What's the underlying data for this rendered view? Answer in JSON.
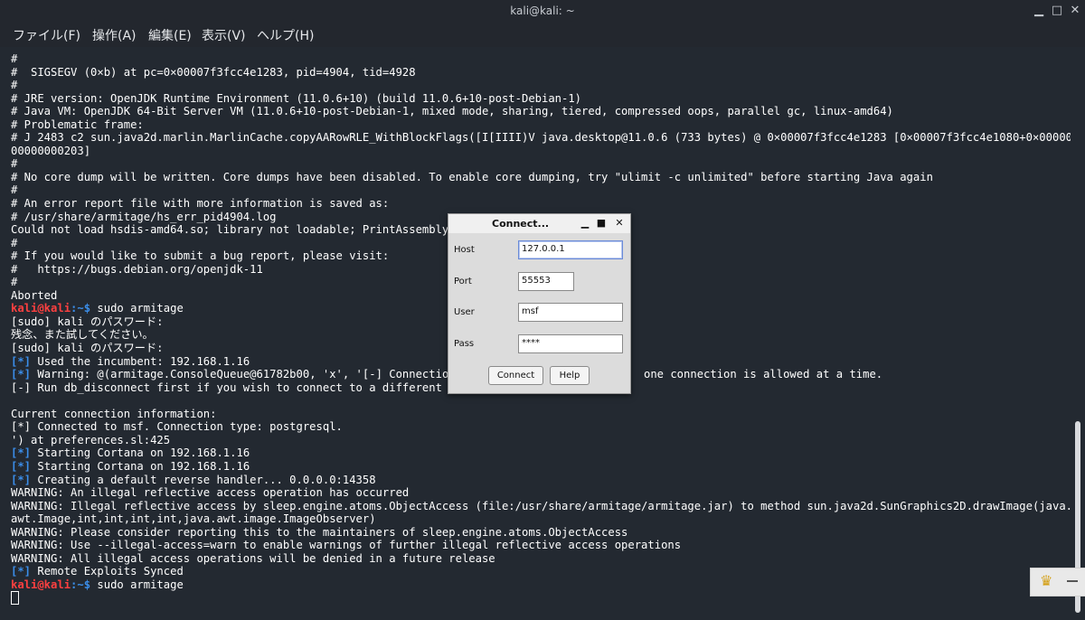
{
  "window": {
    "title": "kali@kali: ~"
  },
  "menu": [
    "ファイル(F)",
    "操作(A)",
    "編集(E)",
    "表示(V)",
    "ヘルプ(H)"
  ],
  "colors": {
    "terminal_bg": "#232931",
    "prompt_red": "#ff4040",
    "info_blue": "#3b8eea"
  },
  "terminal": {
    "lines": [
      "#",
      "#  SIGSEGV (0×b) at pc=0×00007f3fcc4e1283, pid=4904, tid=4928",
      "#",
      "# JRE version: OpenJDK Runtime Environment (11.0.6+10) (build 11.0.6+10-post-Debian-1)",
      "# Java VM: OpenJDK 64-Bit Server VM (11.0.6+10-post-Debian-1, mixed mode, sharing, tiered, compressed oops, parallel gc, linux-amd64)",
      "# Problematic frame:",
      "# J 2483 c2 sun.java2d.marlin.MarlinCache.copyAARowRLE_WithBlockFlags([I[IIII)V java.desktop@11.0.6 (733 bytes) @ 0×00007f3fcc4e1283 [0×00007f3fcc4e1080+0×00000",
      "00000000203]",
      "#",
      "# No core dump will be written. Core dumps have been disabled. To enable core dumping, try \"ulimit -c unlimited\" before starting Java again",
      "#",
      "# An error report file with more information is saved as:",
      "# /usr/share/armitage/hs_err_pid4904.log",
      "Could not load hsdis-amd64.so; library not loadable; PrintAssembly",
      "#",
      "# If you would like to submit a bug report, please visit:",
      "#   https://bugs.debian.org/openjdk-11",
      "#",
      "Aborted",
      "",
      "[sudo] kali のパスワード:",
      "残念、また試してください。",
      "[sudo] kali のパスワード:",
      " Used the incumbent: 192.168.1.16",
      " Warning: @(armitage.ConsoleQueue@61782b00, 'x', '[-] Connection",
      "[-] Run db_disconnect first if you wish to connect to a different",
      "",
      "Current connection information:",
      "[*] Connected to msf. Connection type: postgresql.",
      "') at preferences.sl:425",
      " Starting Cortana on 192.168.1.16",
      " Starting Cortana on 192.168.1.16",
      " Creating a default reverse handler... 0.0.0.0:14358",
      "WARNING: An illegal reflective access operation has occurred",
      "WARNING: Illegal reflective access by sleep.engine.atoms.ObjectAccess (file:/usr/share/armitage/armitage.jar) to method sun.java2d.SunGraphics2D.drawImage(java.",
      "awt.Image,int,int,int,int,java.awt.image.ImageObserver)",
      "WARNING: Please consider reporting this to the maintainers of sleep.engine.atoms.ObjectAccess",
      "WARNING: Use --illegal-access=warn to enable warnings of further illegal reflective access operations",
      "WARNING: All illegal access operations will be denied in a future release",
      " Remote Exploits Synced",
      ""
    ],
    "prompt_user": "kali@kali",
    "prompt_path": ":~$",
    "cmd_sudo": " sudo armitage",
    "info_tag": "[*]",
    "hidden_tail": "one connection is allowed at a time."
  },
  "dialog": {
    "title": "Connect...",
    "host_label": "Host",
    "host_value": "127.0.0.1",
    "port_label": "Port",
    "port_value": "55553",
    "user_label": "User",
    "user_value": "msf",
    "pass_label": "Pass",
    "pass_value": "****",
    "connect_label": "Connect",
    "help_label": "Help"
  }
}
